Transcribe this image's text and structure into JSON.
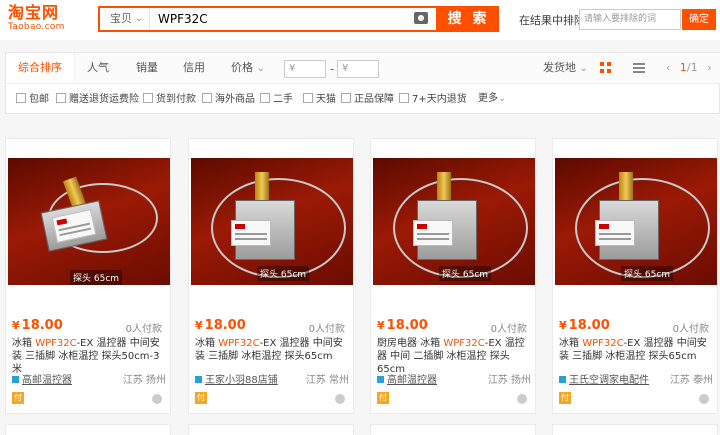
{
  "header": {
    "logo_cn": "淘宝网",
    "logo_en": "Taobao.com",
    "search_category": "宝贝",
    "search_query": "WPF32C",
    "search_button": "搜 索",
    "within_label": "在结果中排除",
    "within_placeholder": "请输入要排除的词",
    "within_button": "确定"
  },
  "sortbar": {
    "items": [
      "综合排序",
      "人气",
      "销量",
      "信用",
      "价格"
    ],
    "price_from": "¥",
    "price_to": "¥",
    "dash": "-",
    "ship_from": "发货地",
    "page_current": "1",
    "page_total": "/1"
  },
  "filters": [
    "包邮",
    "赠送退货运费险",
    "货到付款",
    "海外商品",
    "二手",
    "天猫",
    "正品保障",
    "7+天内退货",
    "更多"
  ],
  "products": [
    {
      "price": "18.00",
      "currency": "¥",
      "deals": "0人付款",
      "title_pre": "冰箱 ",
      "title_hl": "WPF32C",
      "title_post": "-EX 温控器 中间安装 三插脚 冰柜温控 探头50cm-3米",
      "probe": "探头 65cm",
      "shop": "高邮温控器",
      "location": "江苏 扬州"
    },
    {
      "price": "18.00",
      "currency": "¥",
      "deals": "0人付款",
      "title_pre": "冰箱 ",
      "title_hl": "WPF32C",
      "title_post": "-EX 温控器 中间安装 三插脚 冰柜温控 探头65cm",
      "probe": "探头 65cm",
      "shop": "王家小羽88店铺",
      "location": "江苏 常州"
    },
    {
      "price": "18.00",
      "currency": "¥",
      "deals": "0人付款",
      "title_pre": "厨房电器 冰箱 ",
      "title_hl": "WPF32C",
      "title_post": "-EX 温控器 中间 二插脚 冰柜温控 探头65cm",
      "probe": "探头 65cm",
      "shop": "高邮温控器",
      "location": "江苏 扬州"
    },
    {
      "price": "18.00",
      "currency": "¥",
      "deals": "0人付款",
      "title_pre": "冰箱 ",
      "title_hl": "WPF32C",
      "title_post": "-EX 温控器 中间安装 三插脚 冰柜温控 探头65cm",
      "probe": "探头 65cm",
      "shop": "王氏空调家电配件",
      "location": "江苏 泰州"
    }
  ],
  "icons": {
    "pay_badge": "付",
    "chevron": "⌄",
    "prev": "‹",
    "next": "›"
  },
  "colors": {
    "accent": "#ff5000",
    "shop_icon": "#29a0d6"
  }
}
